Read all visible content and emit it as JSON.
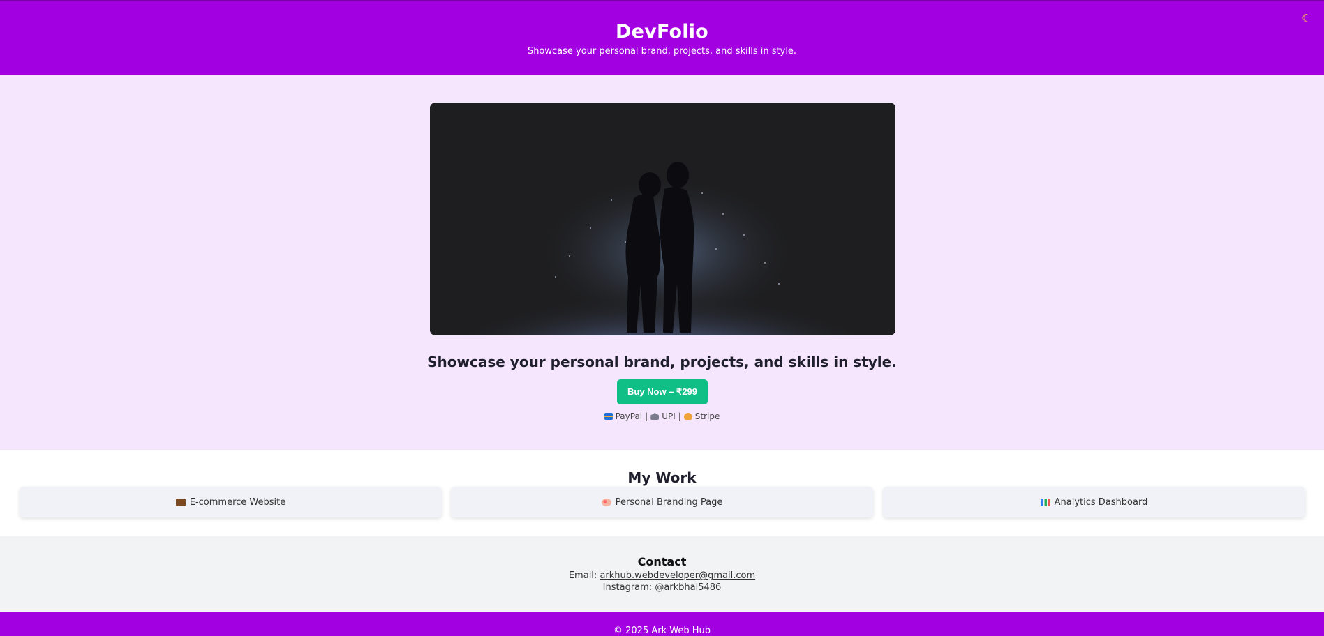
{
  "header": {
    "title": "DevFolio",
    "tagline": "Showcase your personal brand, projects, and skills in style.",
    "theme_toggle_icon": "moon-icon"
  },
  "hero": {
    "image_alt": "Silhouette of couple in the snow at night",
    "heading": "Showcase your personal brand, projects, and skills in style.",
    "buy_label": "Buy Now – ₹299",
    "payments": [
      {
        "icon": "credit-card-icon",
        "label": "PayPal"
      },
      {
        "icon": "bank-icon",
        "label": "UPI"
      },
      {
        "icon": "money-bag-icon",
        "label": "Stripe"
      }
    ]
  },
  "work": {
    "title": "My Work",
    "items": [
      {
        "icon": "briefcase-icon",
        "label": "E-commerce Website"
      },
      {
        "icon": "palette-icon",
        "label": "Personal Branding Page"
      },
      {
        "icon": "bar-chart-icon",
        "label": "Analytics Dashboard"
      }
    ]
  },
  "contact": {
    "title": "Contact",
    "email_prefix": "Email: ",
    "email": "arkhub.webdeveloper@gmail.com",
    "instagram_prefix": "Instagram: ",
    "instagram": "@arkbhai5486"
  },
  "footer": {
    "copyright": "© 2025 Ark Web Hub"
  },
  "colors": {
    "brand": "#a200e0",
    "hero_bg": "#f5e6fe",
    "buy_button": "#10bf86"
  }
}
